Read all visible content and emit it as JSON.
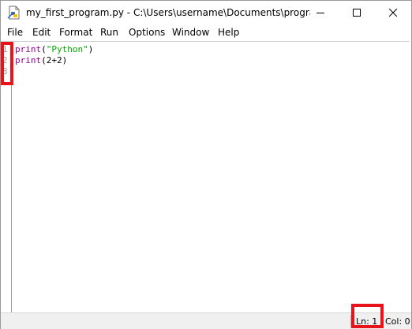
{
  "window": {
    "title": "my_first_program.py - C:\\Users\\username\\Documents\\program...",
    "app_icon": "python-file-icon",
    "controls": {
      "minimize_icon": "minimize-icon",
      "maximize_icon": "maximize-icon",
      "close_icon": "close-icon"
    }
  },
  "menubar": {
    "items": [
      {
        "label": "File"
      },
      {
        "label": "Edit"
      },
      {
        "label": "Format"
      },
      {
        "label": "Run"
      },
      {
        "label": "Options"
      },
      {
        "label": "Window"
      },
      {
        "label": "Help"
      }
    ]
  },
  "editor": {
    "line_numbers": [
      "1",
      "2",
      "3"
    ],
    "lines": [
      {
        "builtin": "print",
        "open": "(",
        "string": "\"Python\"",
        "rest": ")"
      },
      {
        "builtin": "print",
        "open": "",
        "string": "",
        "rest": "(2+2)"
      },
      {
        "builtin": "",
        "open": "",
        "string": "",
        "rest": ""
      }
    ]
  },
  "statusbar": {
    "line": "Ln: 1",
    "column": "Col: 0"
  },
  "colors": {
    "highlight": "#e8141b",
    "builtin": "#900090",
    "string": "#00aa00",
    "line_numbers": "#9a9a9a"
  }
}
